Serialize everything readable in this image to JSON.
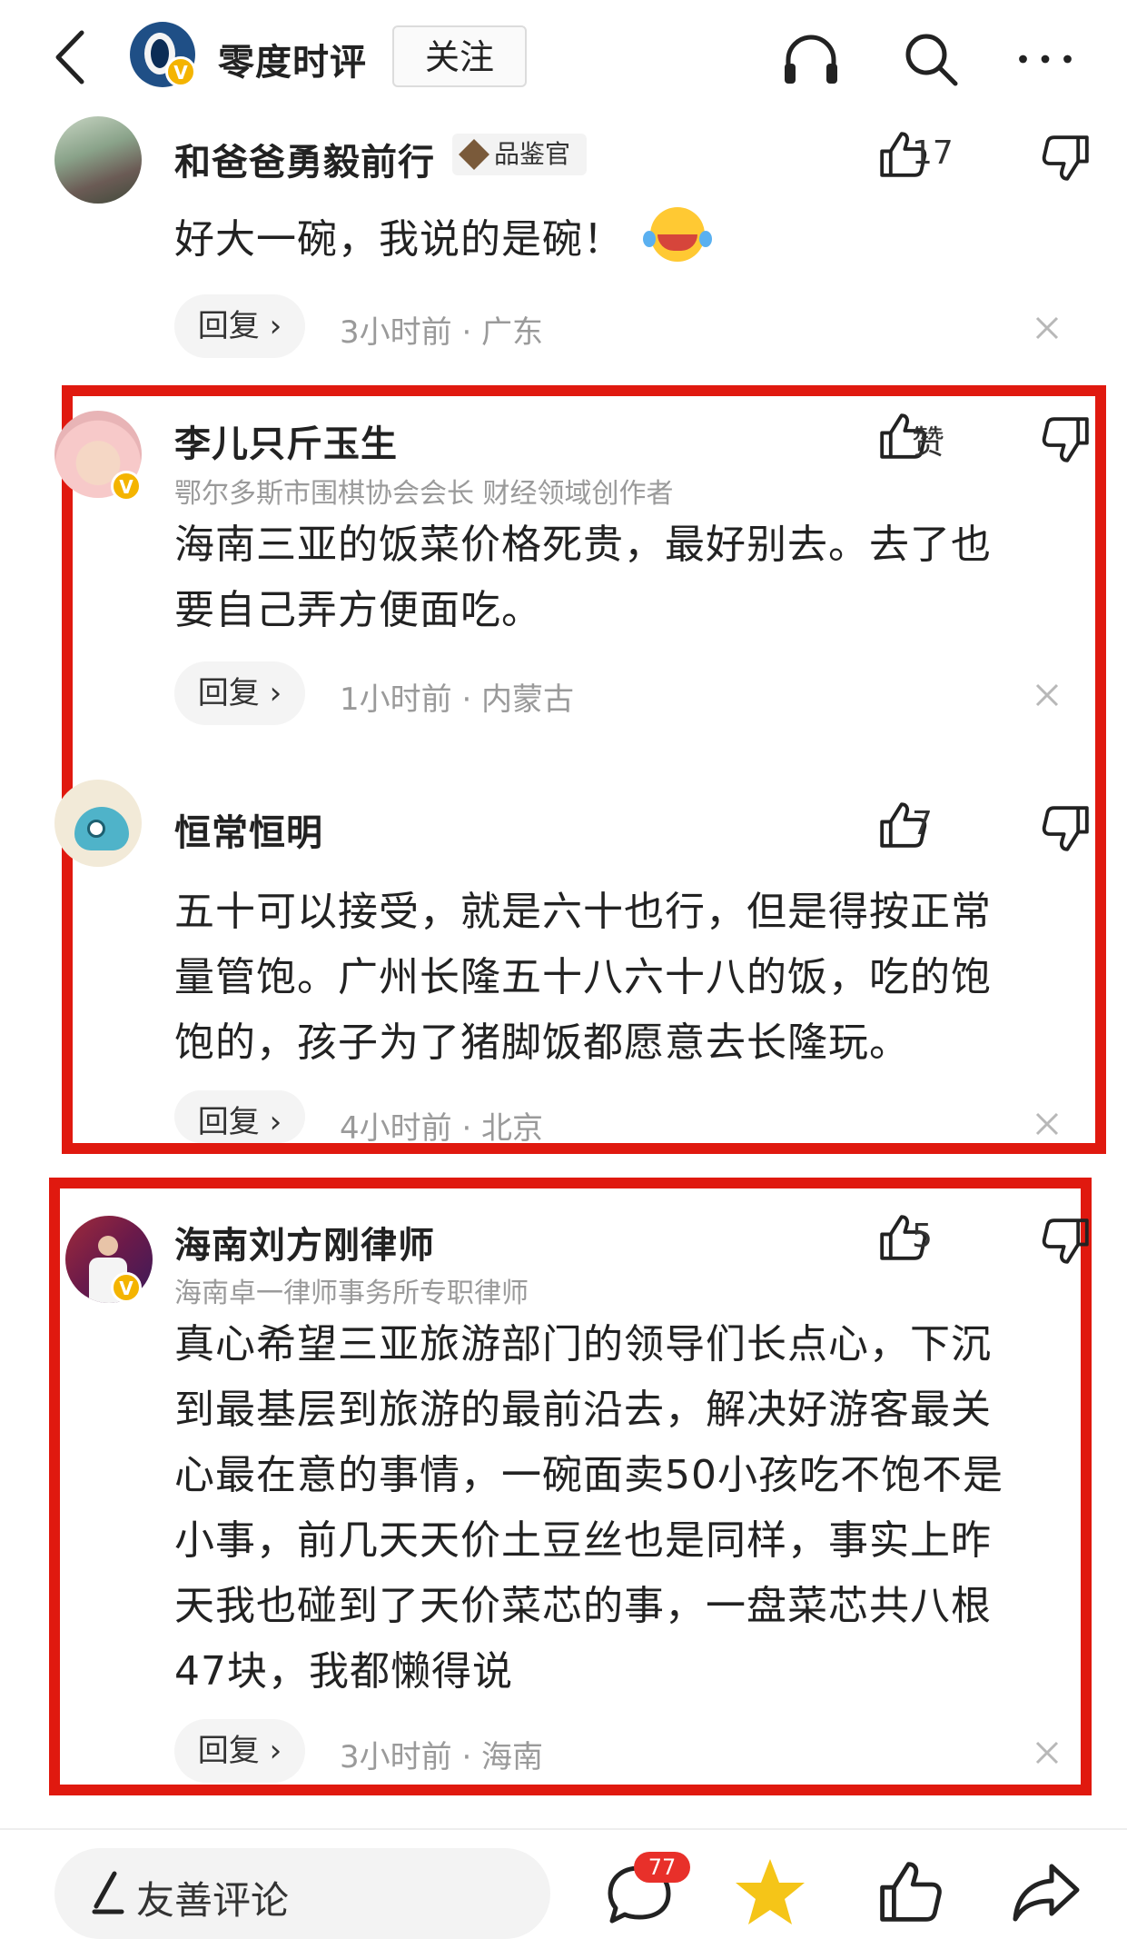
{
  "header": {
    "channel_name": "零度时评",
    "follow_label": "关注",
    "avatar_badge": "V"
  },
  "comments": [
    {
      "user": "和爸爸勇毅前行",
      "badge": "品鉴官",
      "likes": "17",
      "lines": [
        "好大一碗，我说的是碗！"
      ],
      "reply": "回复 ›",
      "meta": "3小时前 · 广东"
    },
    {
      "user": "李儿只斤玉生",
      "subtitle": "鄂尔多斯市围棋协会会长 财经领域创作者",
      "likes": "赞",
      "lines": [
        "海南三亚的饭菜价格死贵，最好别去。去了也",
        "要自己弄方便面吃。"
      ],
      "reply": "回复 ›",
      "meta": "1小时前 · 内蒙古"
    },
    {
      "user": "恒常恒明",
      "likes": "7",
      "lines": [
        "五十可以接受，就是六十也行，但是得按正常",
        "量管饱。广州长隆五十八六十八的饭，吃的饱",
        "饱的，孩子为了猪脚饭都愿意去长隆玩。"
      ],
      "reply": "回复 ›",
      "meta": "4小时前 · 北京"
    },
    {
      "user": "海南刘方刚律师",
      "subtitle": "海南卓一律师事务所专职律师",
      "likes": "5",
      "lines": [
        "真心希望三亚旅游部门的领导们长点心，下沉",
        "到最基层到旅游的最前沿去，解决好游客最关",
        "心最在意的事情，一碗面卖50小孩吃不饱不是",
        "小事，前几天天价土豆丝也是同样，事实上昨",
        "天我也碰到了天价菜芯的事，一盘菜芯共八根",
        "47块，我都懒得说"
      ],
      "reply": "回复 ›",
      "meta": "3小时前 · 海南"
    }
  ],
  "bottom": {
    "input_placeholder": "友善评论",
    "comment_count": "77"
  },
  "colors": {
    "highlight_border": "#e0190f",
    "verified_badge": "#f4b400",
    "star": "#f5c518",
    "count_badge": "#e8302a"
  }
}
